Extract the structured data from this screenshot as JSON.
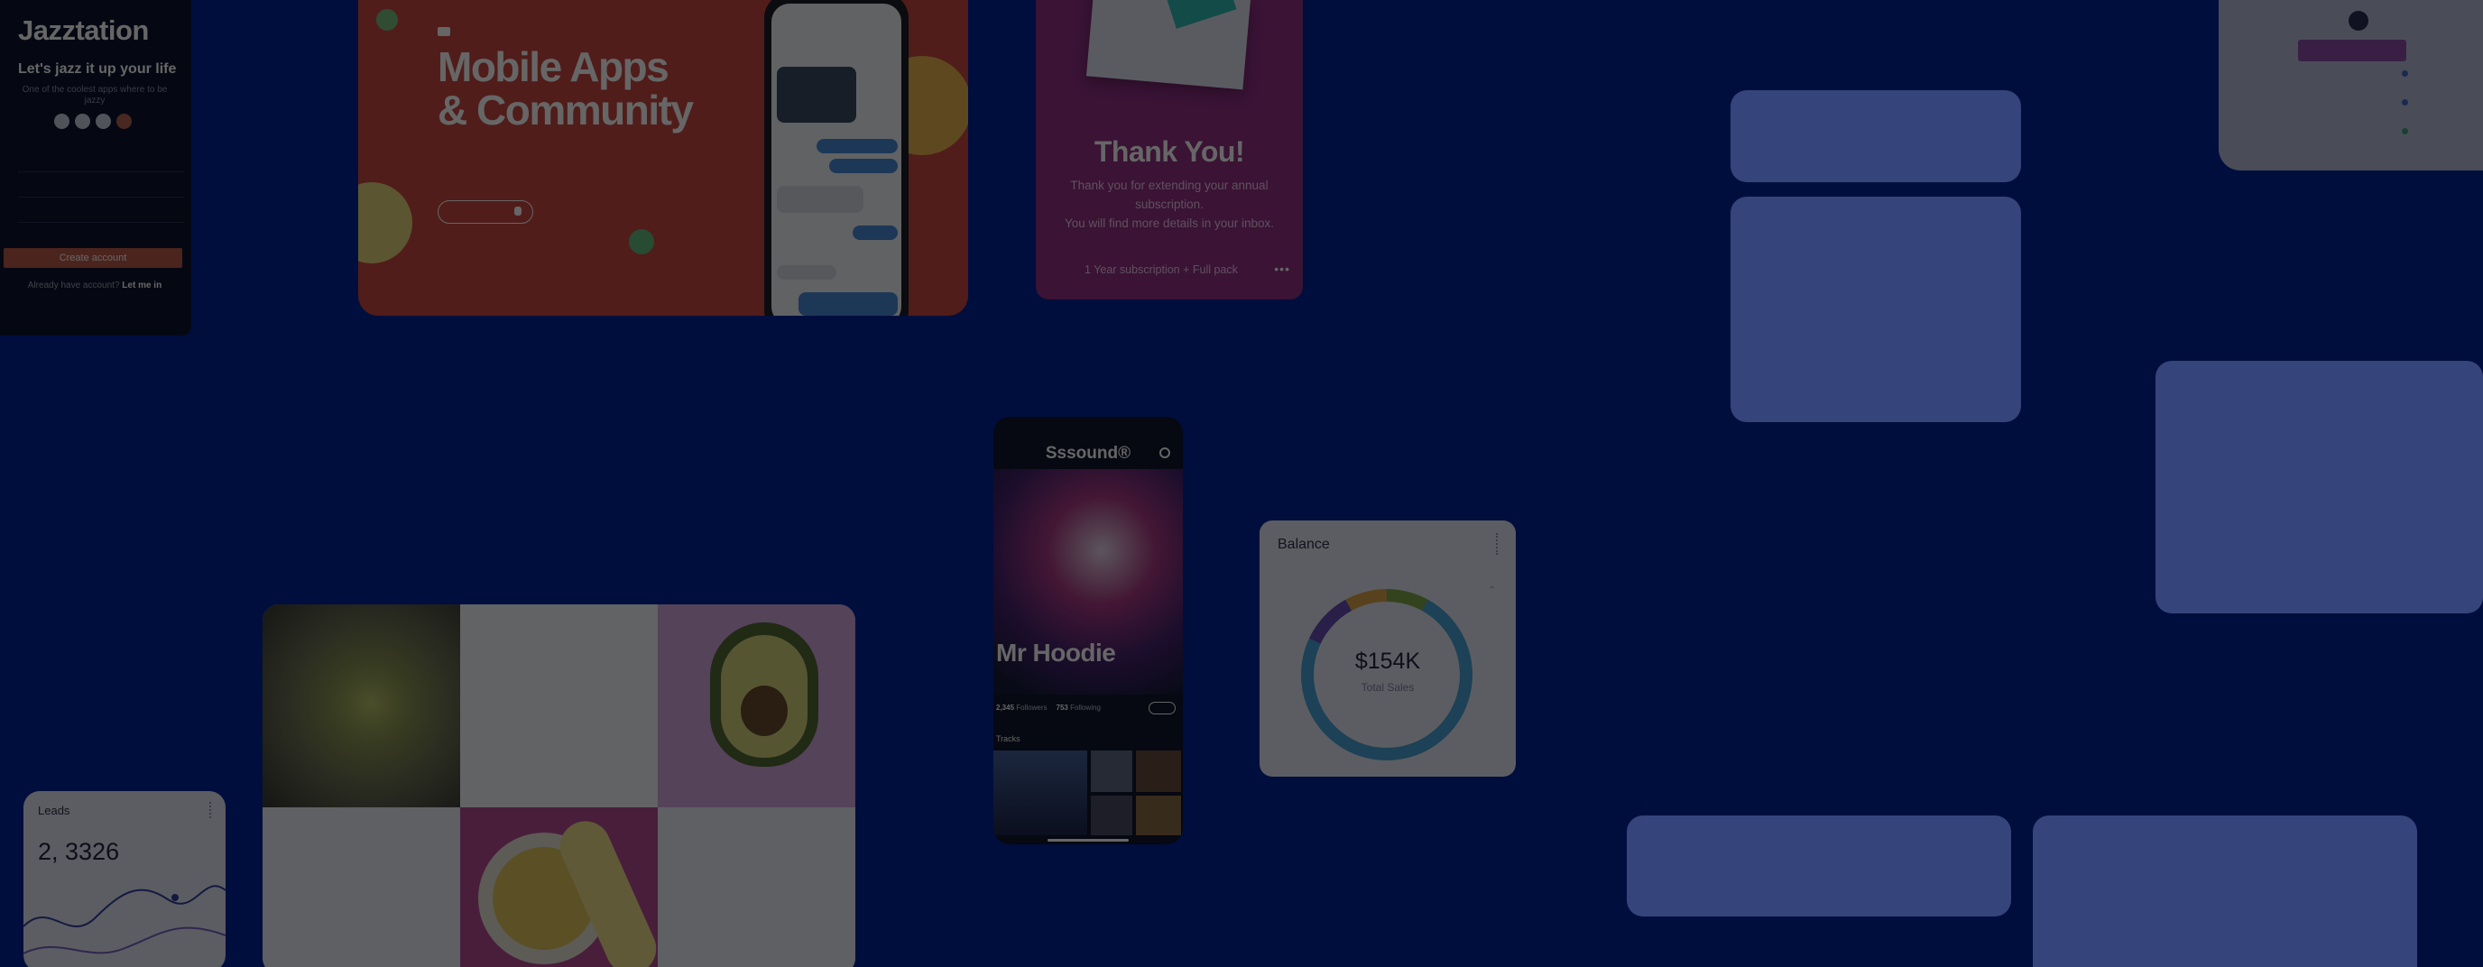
{
  "colors": {
    "background": "#000e3d",
    "overlay_placeholder": "#3b4a82",
    "accent_red": "#d9453a",
    "accent_magenta": "#9d2a8f"
  },
  "jazztation": {
    "logo": "Jazztation",
    "tagline": "Let's jazz it up your life",
    "description": "One of the coolest apps where to be jazzy",
    "socials": [
      "twitter-icon",
      "facebook-icon",
      "pinterest-icon",
      "google-icon"
    ],
    "cta": "Create account",
    "login_prompt": "Already have account?",
    "login_link": "Let me in"
  },
  "mobile_apps": {
    "title_line1": "Mobile Apps",
    "title_line2": "& Community"
  },
  "thank_you": {
    "title": "Thank You!",
    "message_line1": "Thank you for extending your annual",
    "message_line2": "subscription.",
    "message_line3": "You will find more details in your inbox.",
    "plan": "1 Year subscription + Full pack",
    "more_icon": "more-horizontal-icon"
  },
  "sssound": {
    "logo": "Sssound®",
    "artist": "Mr Hoodie",
    "followers": "2,345",
    "followers_label": "Followers",
    "following": "753",
    "following_label": "Following",
    "tracks_label": "Tracks",
    "settings_icon": "gear-icon"
  },
  "balance": {
    "label": "Balance",
    "amount": "$154K",
    "sub": "Total Sales",
    "segments": [
      {
        "color": "#7baa3c",
        "share": 0.08
      },
      {
        "color": "#3ba4e2",
        "share": 0.74
      },
      {
        "color": "#6a4ac6",
        "share": 0.1
      },
      {
        "color": "#e6a33a",
        "share": 0.08
      }
    ]
  },
  "leads": {
    "label": "Leads",
    "value": "2, 3326"
  }
}
